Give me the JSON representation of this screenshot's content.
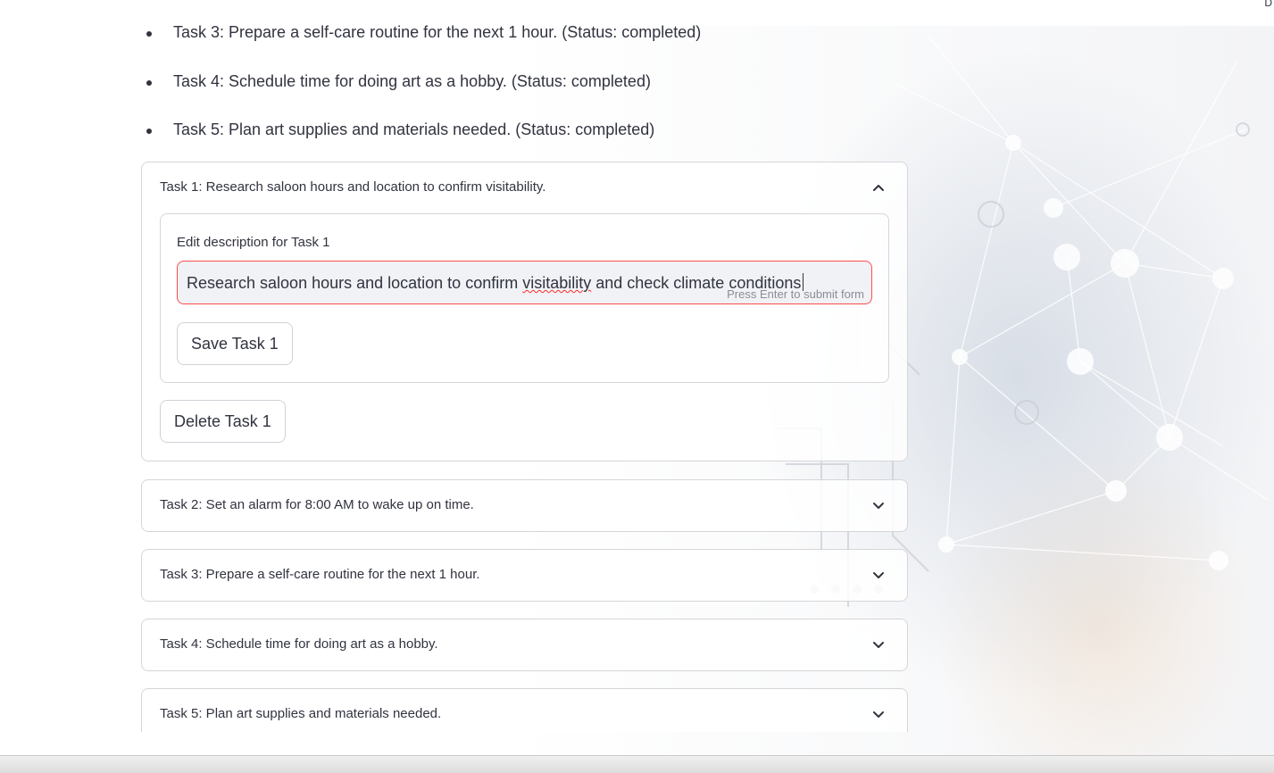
{
  "top_corner_text": "D",
  "status_list": [
    "Task 3: Prepare a self-care routine for the next 1 hour. (Status: completed)",
    "Task 4: Schedule time for doing art as a hobby. (Status: completed)",
    "Task 5: Plan art supplies and materials needed. (Status: completed)"
  ],
  "expanders": [
    {
      "title": "Task 1: Research saloon hours and location to confirm visitability.",
      "expanded": true,
      "form": {
        "label": "Edit description for Task 1",
        "value_before": "Research saloon hours and location to confirm ",
        "value_misspelled": "visitability",
        "value_after": " and check climate conditions",
        "hint": "Press Enter to submit form",
        "save_label": "Save Task 1"
      },
      "delete_label": "Delete Task 1"
    },
    {
      "title": "Task 2: Set an alarm for 8:00 AM to wake up on time.",
      "expanded": false
    },
    {
      "title": "Task 3: Prepare a self-care routine for the next 1 hour.",
      "expanded": false
    },
    {
      "title": "Task 4: Schedule time for doing art as a hobby.",
      "expanded": false
    },
    {
      "title": "Task 5: Plan art supplies and materials needed.",
      "expanded": false
    }
  ],
  "icons": {
    "expanded": "chevron-up-icon",
    "collapsed": "chevron-down-icon"
  },
  "colors": {
    "text": "#31333f",
    "error_border": "#ff4b4b",
    "input_bg": "#f0f2f6",
    "border": "#d6d6d9"
  }
}
